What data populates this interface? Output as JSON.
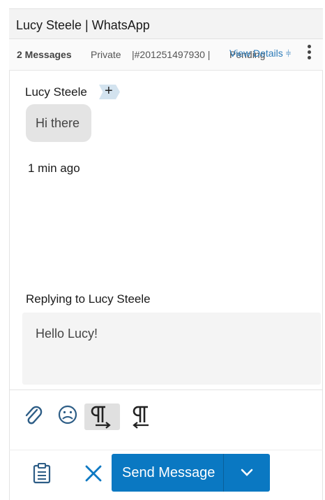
{
  "header": {
    "title": "Lucy Steele | WhatsApp"
  },
  "info": {
    "message_count": "2 Messages",
    "privacy": "Private",
    "ticket": "|#201251497930  |",
    "status": "Pending",
    "view_details": "View Details"
  },
  "conversation": {
    "sender": "Lucy Steele",
    "message": "Hi there",
    "timestamp": "1 min ago"
  },
  "reply": {
    "replying_to": "Replying to Lucy Steele",
    "draft": "Hello Lucy!"
  },
  "actions": {
    "send_label": "Send Message"
  },
  "colors": {
    "accent": "#0a78c2",
    "link": "#2a7ab8",
    "bubble": "#e4e4e4",
    "tag": "#d3e3ef"
  }
}
